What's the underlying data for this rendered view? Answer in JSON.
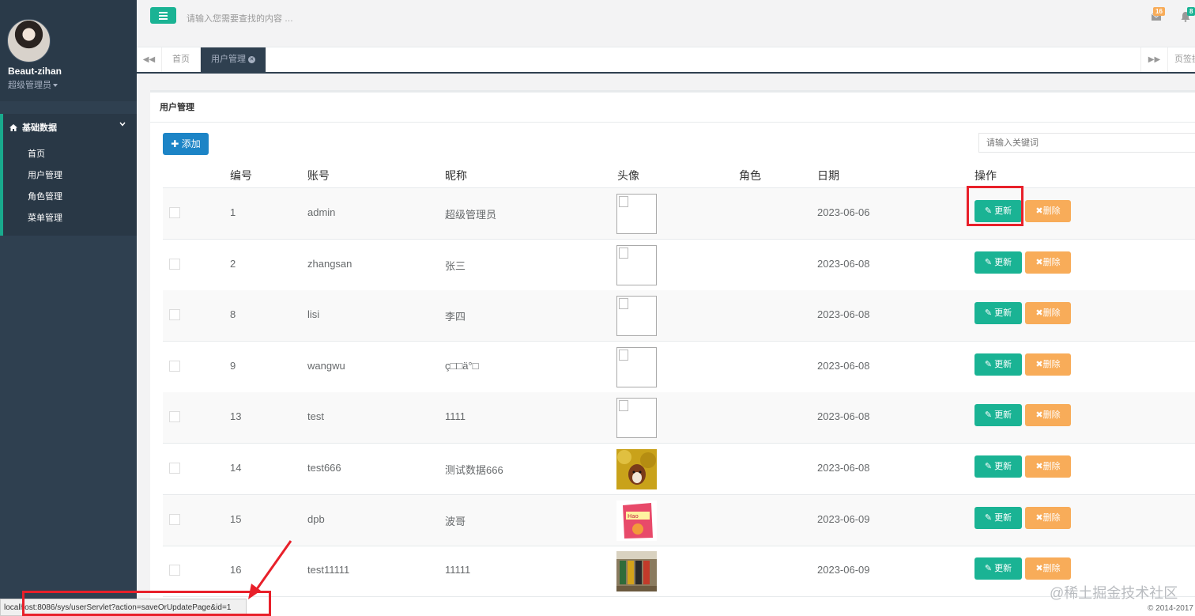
{
  "sidebar": {
    "user_name": "Beaut-zihan",
    "user_role": "超级管理员",
    "group_label": "基础数据",
    "items": [
      {
        "label": "首页"
      },
      {
        "label": "用户管理"
      },
      {
        "label": "角色管理"
      },
      {
        "label": "菜单管理"
      }
    ]
  },
  "topbar": {
    "search_placeholder": "请输入您需要查找的内容 …",
    "mail_badge": "16",
    "bell_badge": "8"
  },
  "tabs": {
    "items": [
      {
        "label": "首页",
        "active": false
      },
      {
        "label": "用户管理",
        "active": true
      }
    ],
    "extra_label": "页签操作"
  },
  "panel": {
    "title": "用户管理",
    "add_label": "添加",
    "keyword_placeholder": "请输入关键词",
    "columns": [
      "编号",
      "账号",
      "昵称",
      "头像",
      "角色",
      "日期",
      "操作"
    ],
    "update_label": "更新",
    "delete_label": "删除",
    "rows": [
      {
        "id": "1",
        "account": "admin",
        "nickname": "超级管理员",
        "role": "",
        "date": "2023-06-06",
        "avatar": "broken"
      },
      {
        "id": "2",
        "account": "zhangsan",
        "nickname": "张三",
        "role": "",
        "date": "2023-06-08",
        "avatar": "broken"
      },
      {
        "id": "8",
        "account": "lisi",
        "nickname": "李四",
        "role": "",
        "date": "2023-06-08",
        "avatar": "broken"
      },
      {
        "id": "9",
        "account": "wangwu",
        "nickname": "ç□□ä°□",
        "role": "",
        "date": "2023-06-08",
        "avatar": "broken"
      },
      {
        "id": "13",
        "account": "test",
        "nickname": "1111",
        "role": "",
        "date": "2023-06-08",
        "avatar": "broken"
      },
      {
        "id": "14",
        "account": "test666",
        "nickname": "测试数据666",
        "role": "",
        "date": "2023-06-08",
        "avatar": "dog-photo"
      },
      {
        "id": "15",
        "account": "dpb",
        "nickname": "波哥",
        "role": "",
        "date": "2023-06-09",
        "avatar": "snack-photo"
      },
      {
        "id": "16",
        "account": "test11111",
        "nickname": "11111",
        "role": "",
        "date": "2023-06-09",
        "avatar": "shelf-photo"
      }
    ]
  },
  "status": {
    "url": "localhost:8086/sys/userServlet?action=saveOrUpdatePage&id=1",
    "copyright": "© 2014-2017",
    "watermark": "@稀土掘金技术社区"
  },
  "colors": {
    "sidebar": "#2f4050",
    "primary": "#1ab394",
    "info": "#1c84c6",
    "warning": "#f8ac59",
    "highlight": "#e8202a"
  }
}
